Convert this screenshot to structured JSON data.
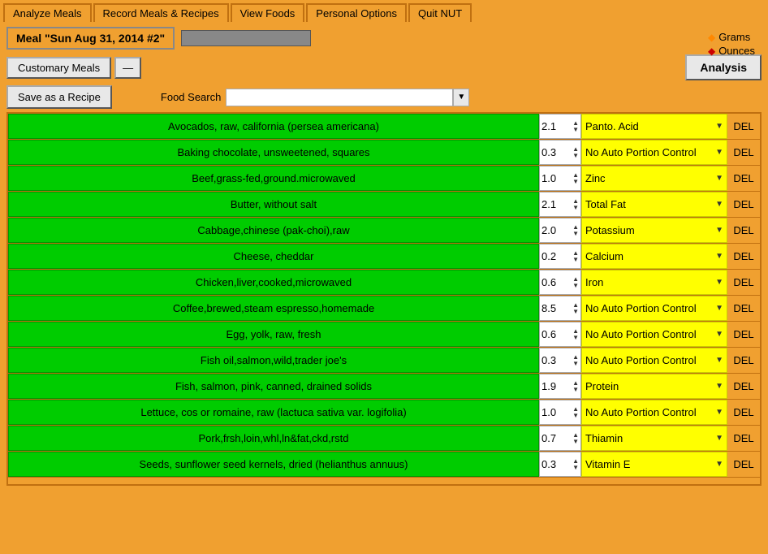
{
  "menu": {
    "tabs": [
      {
        "label": "Analyze Meals"
      },
      {
        "label": "Record Meals & Recipes"
      },
      {
        "label": "View Foods"
      },
      {
        "label": "Personal Options"
      },
      {
        "label": "Quit NUT"
      }
    ]
  },
  "meal": {
    "title": "Meal \"Sun Aug 31, 2014 #2\""
  },
  "top_right": {
    "grams_label": "Grams",
    "ounces_label": "Ounces"
  },
  "customary_btn": "Customary Meals",
  "minus_btn": "—",
  "analysis_btn": "Analysis",
  "save_btn": "Save as a Recipe",
  "food_search_label": "Food Search",
  "foods": [
    {
      "name": "Avocados, raw, california (persea americana)",
      "qty": "2.1",
      "nutrient": "Panto. Acid"
    },
    {
      "name": "Baking chocolate, unsweetened, squares",
      "qty": "0.3",
      "nutrient": "No Auto Portion Control"
    },
    {
      "name": "Beef,grass-fed,ground.microwaved",
      "qty": "1.0",
      "nutrient": "Zinc"
    },
    {
      "name": "Butter, without salt",
      "qty": "2.1",
      "nutrient": "Total Fat"
    },
    {
      "name": "Cabbage,chinese (pak-choi),raw",
      "qty": "2.0",
      "nutrient": "Potassium"
    },
    {
      "name": "Cheese, cheddar",
      "qty": "0.2",
      "nutrient": "Calcium"
    },
    {
      "name": "Chicken,liver,cooked,microwaved",
      "qty": "0.6",
      "nutrient": "Iron"
    },
    {
      "name": "Coffee,brewed,steam espresso,homemade",
      "qty": "8.5",
      "nutrient": "No Auto Portion Control"
    },
    {
      "name": "Egg, yolk, raw, fresh",
      "qty": "0.6",
      "nutrient": "No Auto Portion Control"
    },
    {
      "name": "Fish oil,salmon,wild,trader joe's",
      "qty": "0.3",
      "nutrient": "No Auto Portion Control"
    },
    {
      "name": "Fish, salmon, pink, canned, drained solids",
      "qty": "1.9",
      "nutrient": "Protein"
    },
    {
      "name": "Lettuce, cos or romaine, raw (lactuca sativa var. logifolia)",
      "qty": "1.0",
      "nutrient": "No Auto Portion Control"
    },
    {
      "name": "Pork,frsh,loin,whl,ln&fat,ckd,rstd",
      "qty": "0.7",
      "nutrient": "Thiamin"
    },
    {
      "name": "Seeds, sunflower seed kernels, dried (helianthus annuus)",
      "qty": "0.3",
      "nutrient": "Vitamin E"
    }
  ],
  "del_label": "DEL"
}
